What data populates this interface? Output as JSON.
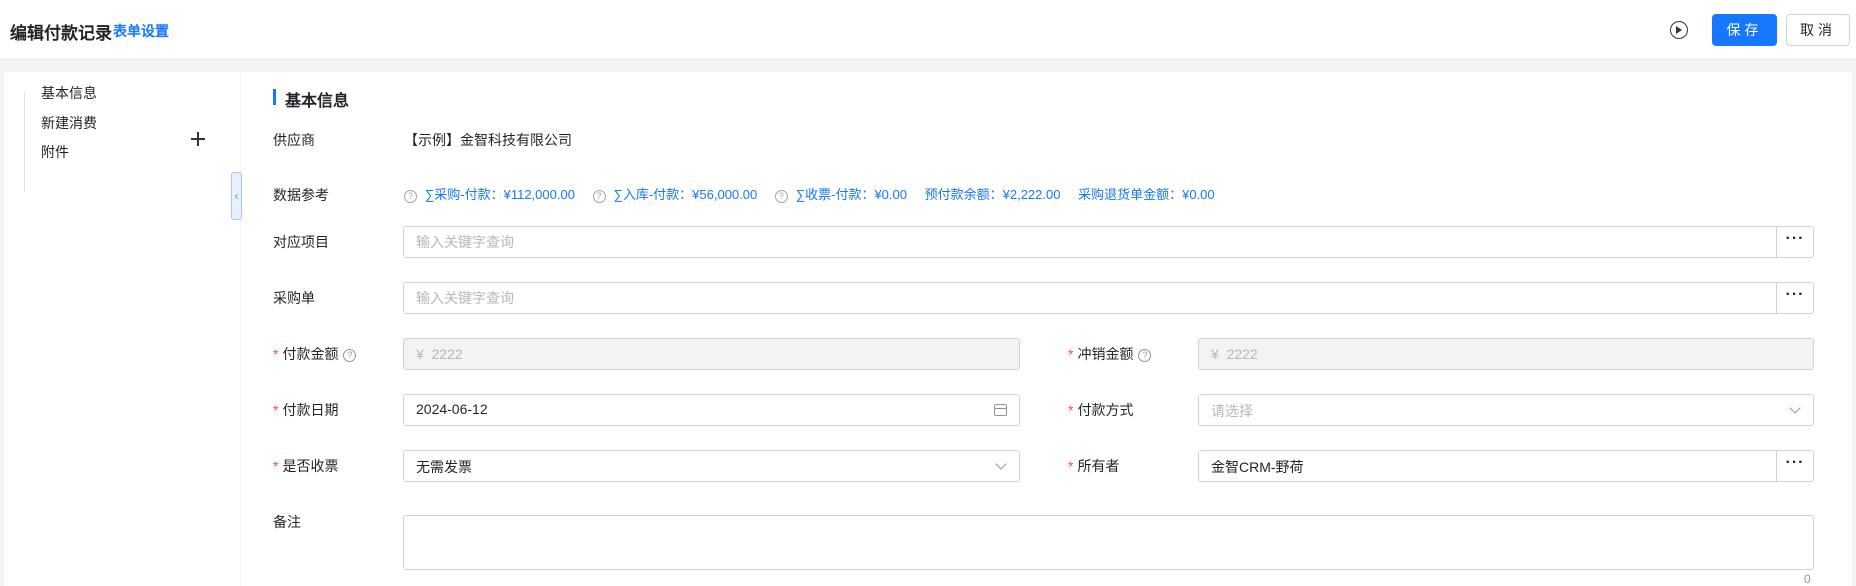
{
  "header": {
    "title": "编辑付款记录",
    "form_settings_link": "表单设置",
    "save_label": "保存",
    "cancel_label": "取消"
  },
  "sidebar": {
    "items": [
      {
        "label": "基本信息"
      },
      {
        "label": "新建消费"
      },
      {
        "label": "附件"
      }
    ]
  },
  "section": {
    "title": "基本信息"
  },
  "form": {
    "supplier": {
      "label": "供应商",
      "value": "【示例】金智科技有限公司"
    },
    "data_reference": {
      "label": "数据参考",
      "items": [
        {
          "text": "∑采购-付款：¥112,000.00",
          "has_help": true
        },
        {
          "text": "∑入库-付款：¥56,000.00",
          "has_help": true
        },
        {
          "text": "∑收票-付款：¥0.00",
          "has_help": true
        },
        {
          "text": "预付款余额：¥2,222.00",
          "has_help": false
        },
        {
          "text": "采购退货单金额：¥0.00",
          "has_help": false
        }
      ]
    },
    "project": {
      "label": "对应项目",
      "placeholder": "输入关键字查询"
    },
    "purchase_order": {
      "label": "采购单",
      "placeholder": "输入关键字查询"
    },
    "payment_amount": {
      "label": "付款金额",
      "required": true,
      "value": "¥  2222"
    },
    "writeoff_amount": {
      "label": "冲销金额",
      "required": true,
      "value": "¥  2222"
    },
    "payment_date": {
      "label": "付款日期",
      "required": true,
      "value": "2024-06-12"
    },
    "payment_method": {
      "label": "付款方式",
      "required": true,
      "placeholder": "请选择"
    },
    "invoice_received": {
      "label": "是否收票",
      "required": true,
      "value": "无需发票"
    },
    "owner": {
      "label": "所有者",
      "required": true,
      "value": "金智CRM-野荷"
    },
    "remarks": {
      "label": "备注",
      "char_count": "0"
    }
  },
  "icons": {
    "help": "question-circle-icon",
    "more": "ellipsis-icon",
    "calendar": "calendar-icon",
    "dropdown": "chevron-down-icon",
    "add": "plus-icon",
    "collapse": "chevron-left-icon",
    "run": "play-circle-icon"
  },
  "colors": {
    "primary": "#1677ff",
    "required": "#f54a45"
  }
}
